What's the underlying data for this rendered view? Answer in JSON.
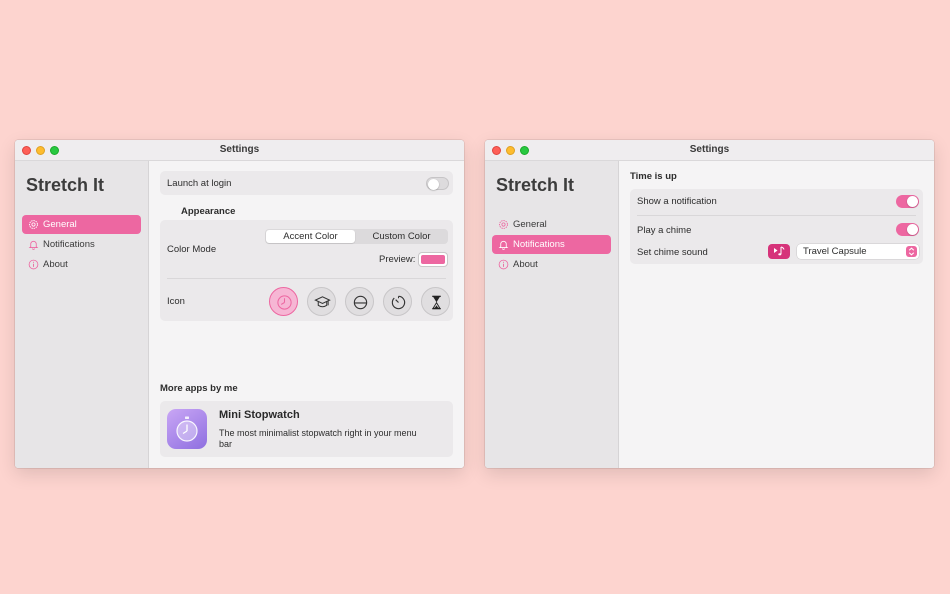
{
  "accent_color": "#ed67a1",
  "windows": {
    "general": {
      "title": "Settings",
      "sidebar": {
        "brand": "Stretch It",
        "items": [
          {
            "label": "General",
            "icon": "gear-icon",
            "active": true
          },
          {
            "label": "Notifications",
            "icon": "bell-icon",
            "active": false
          },
          {
            "label": "About",
            "icon": "info-icon",
            "active": false
          }
        ]
      },
      "launch_at_login": {
        "label": "Launch at login",
        "on": false
      },
      "appearance": {
        "heading": "Appearance",
        "color_mode_label": "Color Mode",
        "segments": [
          "Accent Color",
          "Custom Color"
        ],
        "selected_segment": "Accent Color",
        "preview_label": "Preview:",
        "preview_color": "#ed67a1",
        "icon_label": "Icon",
        "icon_options": [
          "clock-icon",
          "graduation-cap-icon",
          "half-circle-icon",
          "timer-icon",
          "hourglass-icon"
        ],
        "selected_icon": "clock-icon"
      },
      "more_apps": {
        "heading": "More apps by me",
        "app_name": "Mini Stopwatch",
        "app_description": "The most minimalist stopwatch right in your menu bar",
        "app_icon": "stopwatch-icon"
      }
    },
    "notifications": {
      "title": "Settings",
      "sidebar": {
        "brand": "Stretch It",
        "items": [
          {
            "label": "General",
            "icon": "gear-icon",
            "active": false
          },
          {
            "label": "Notifications",
            "icon": "bell-icon",
            "active": true
          },
          {
            "label": "About",
            "icon": "info-icon",
            "active": false
          }
        ]
      },
      "section_heading": "Time is up",
      "show_notification": {
        "label": "Show a notification",
        "on": true
      },
      "play_chime": {
        "label": "Play a chime",
        "on": true
      },
      "chime_sound": {
        "label": "Set chime sound",
        "value": "Travel Capsule",
        "play_icon": "music-note-play-icon"
      }
    }
  }
}
